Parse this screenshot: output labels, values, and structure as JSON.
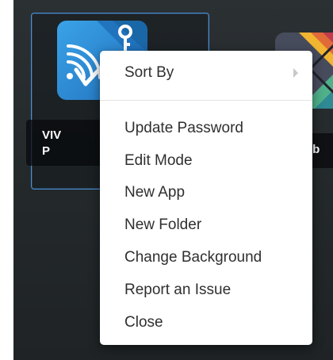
{
  "desktop": {
    "selected_app": {
      "label_line1": "VIV",
      "label_line2": "P"
    },
    "neighbor_app": {
      "label": "gb"
    }
  },
  "context_menu": {
    "sort_by": "Sort By",
    "items": [
      "Update Password",
      "Edit Mode",
      "New App",
      "New Folder",
      "Change Background",
      "Report an Issue",
      "Close"
    ]
  },
  "colors": {
    "selection_border": "#4a90d9",
    "app_icon_blue": "#2c86cf",
    "menu_text": "#2f2f2f",
    "desktop_background": "#272c2f"
  }
}
